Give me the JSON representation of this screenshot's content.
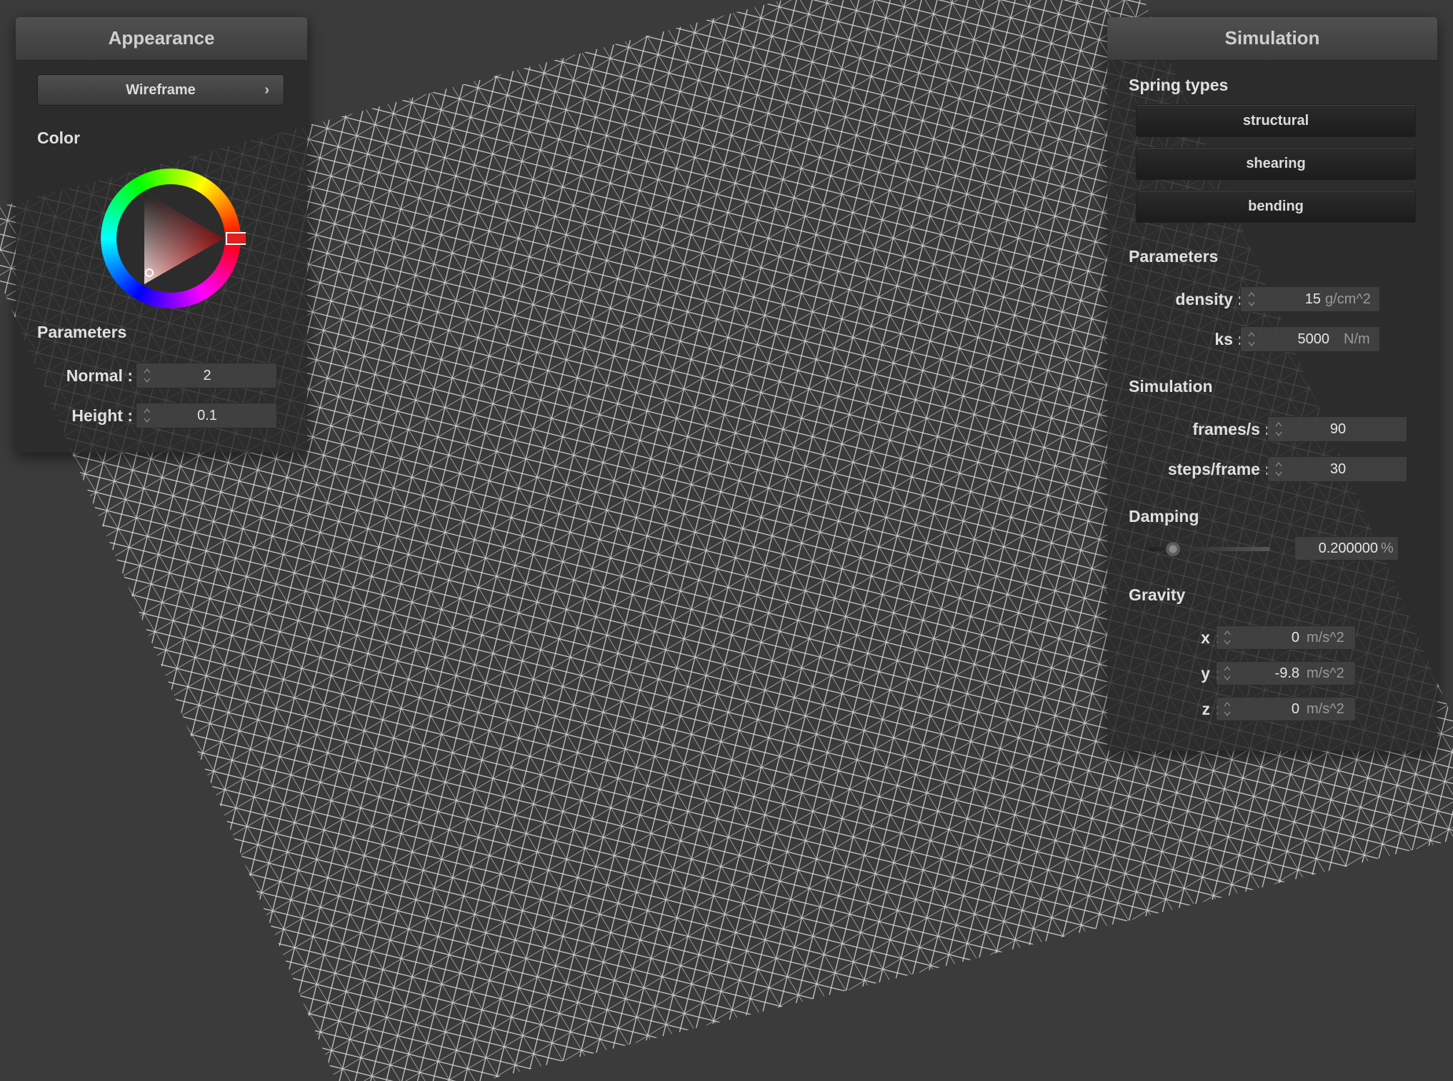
{
  "appearance": {
    "title": "Appearance",
    "mode_label": "Wireframe",
    "color_label": "Color",
    "color_hex": "#ff2a2a",
    "parameters_label": "Parameters",
    "normal_label": "Normal :",
    "normal_value": "2",
    "height_label": "Height :",
    "height_value": "0.1"
  },
  "simulation": {
    "title": "Simulation",
    "spring_types_label": "Spring types",
    "spring_types": [
      "structural",
      "shearing",
      "bending"
    ],
    "parameters_label": "Parameters",
    "density_label": "density :",
    "density_value": "15",
    "density_unit": "g/cm^2",
    "ks_label": "ks :",
    "ks_value": "5000",
    "ks_unit": "N/m",
    "simulation_label": "Simulation",
    "fps_label": "frames/s :",
    "fps_value": "90",
    "steps_label": "steps/frame :",
    "steps_value": "30",
    "damping_label": "Damping",
    "damping_value": "0.200000",
    "damping_unit": "%",
    "damping_slider_fraction": 0.2,
    "gravity_label": "Gravity",
    "gx_label": "x :",
    "gx_value": "0",
    "gy_label": "y :",
    "gy_value": "-9.8",
    "gz_label": "z :",
    "gz_value": "0",
    "gravity_unit": "m/s^2"
  }
}
